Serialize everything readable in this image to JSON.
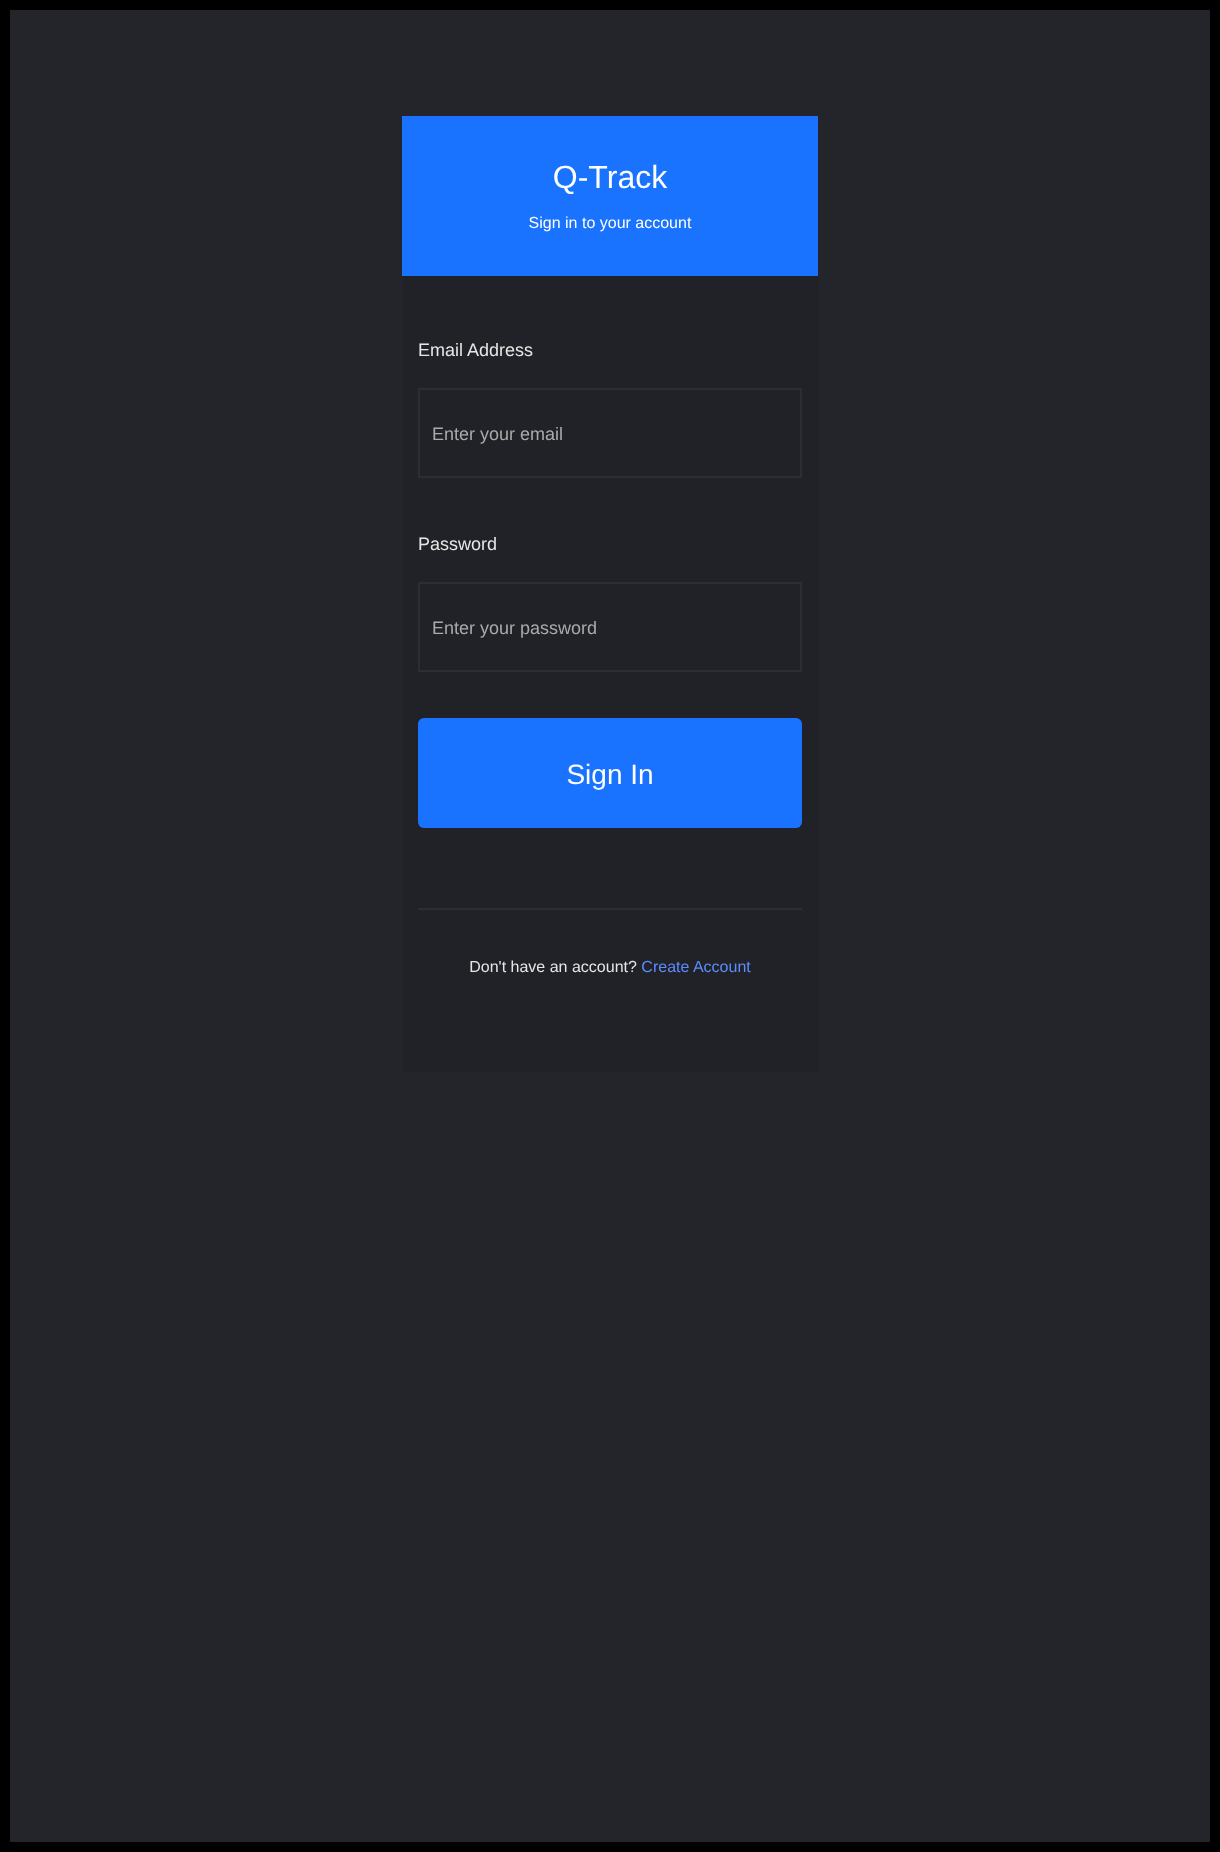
{
  "header": {
    "title": "Q-Track",
    "subtitle": "Sign in to your account"
  },
  "fields": [
    {
      "label": "Email Address",
      "placeholder": "Enter your email"
    },
    {
      "label": "Password",
      "placeholder": "Enter your password"
    }
  ],
  "submit": "Sign In",
  "footer": {
    "text": "Don't have an account?",
    "link": "Create Account"
  }
}
